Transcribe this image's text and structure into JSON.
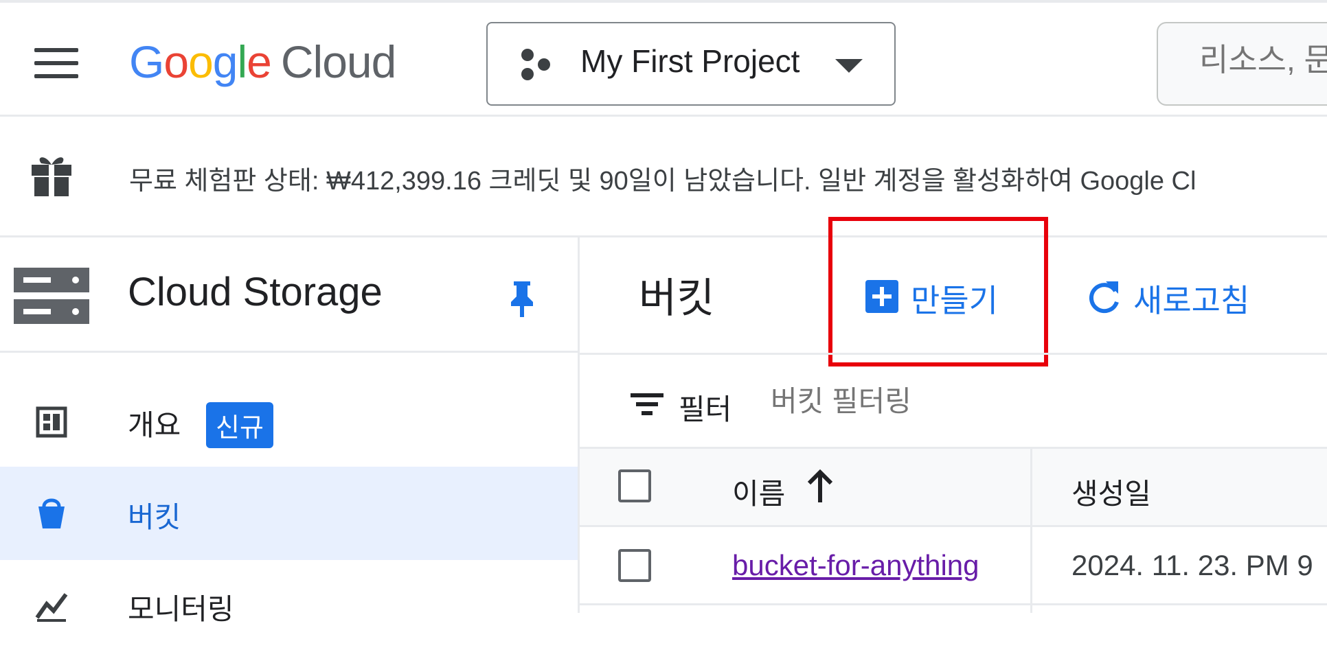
{
  "header": {
    "logo": {
      "google": "Google",
      "cloud": "Cloud"
    },
    "project_name": "My First Project",
    "search_placeholder": "리소스, 문"
  },
  "banner": {
    "text": "무료 체험판 상태: ₩412,399.16 크레딧 및 90일이 남았습니다. 일반 계정을 활성화하여 Google Cl"
  },
  "sidebar": {
    "title": "Cloud Storage",
    "items": [
      {
        "label": "개요",
        "badge": "신규",
        "icon": "dashboard-icon"
      },
      {
        "label": "버킷",
        "icon": "bucket-icon",
        "selected": true
      },
      {
        "label": "모니터링",
        "icon": "monitoring-icon"
      }
    ]
  },
  "main": {
    "title": "버킷",
    "create_label": "만들기",
    "refresh_label": "새로고침",
    "filter_label": "필터",
    "filter_placeholder": "버킷 필터링",
    "table": {
      "columns": [
        "이름",
        "생성일"
      ],
      "rows": [
        {
          "name": "bucket-for-anything",
          "created": "2024. 11. 23. PM 9"
        }
      ]
    }
  },
  "colors": {
    "accent": "#1a73e8",
    "highlight": "#e8000b",
    "link_visited": "#681da8",
    "selected_bg": "#e8f0fe"
  }
}
